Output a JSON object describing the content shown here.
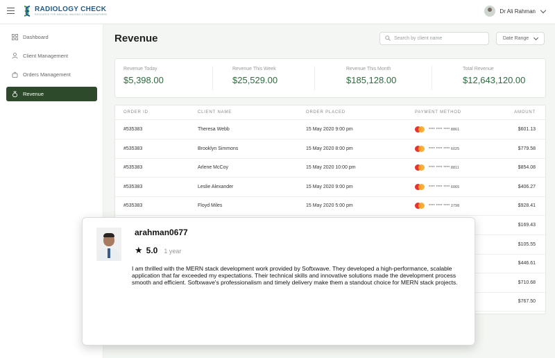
{
  "app": {
    "logo_title": "RADIOLOGY CHECK",
    "logo_subtitle": "RESOURCE FOR MEDICAL IMAGING & RADIOGRAPHERS"
  },
  "header": {
    "user_name": "Dr Ali Rahman"
  },
  "sidebar": {
    "items": [
      {
        "label": "Dashboard",
        "icon": "dashboard-icon",
        "active": false
      },
      {
        "label": "Client Management",
        "icon": "user-icon",
        "active": false
      },
      {
        "label": "Orders Management",
        "icon": "bag-icon",
        "active": false
      },
      {
        "label": "Revenue",
        "icon": "money-bag-icon",
        "active": true
      }
    ]
  },
  "page": {
    "title": "Revenue",
    "search_placeholder": "Search by client name",
    "date_range_label": "Date Range"
  },
  "stats": [
    {
      "label": "Revenue Today",
      "value": "$5,398.00"
    },
    {
      "label": "Revenue This Week",
      "value": "$25,529.00"
    },
    {
      "label": "Revenue This Month",
      "value": "$185,128.00"
    },
    {
      "label": "Total Revenue",
      "value": "$12,643,120.00"
    }
  ],
  "table": {
    "headers": [
      "ORDER ID",
      "CLIENT NAME",
      "ORDER PLACED",
      "PAYMENT METHOD",
      "AMOUNT"
    ],
    "rows": [
      {
        "order_id": "#535383",
        "client": "Theresa Webb",
        "placed": "15 May 2020 9:00 pm",
        "card": "**** **** **** 8861",
        "amount": "$601.13"
      },
      {
        "order_id": "#535383",
        "client": "Brooklyn Simmons",
        "placed": "15 May 2020 8:00 pm",
        "card": "**** **** **** 6025",
        "amount": "$779.58"
      },
      {
        "order_id": "#535383",
        "client": "Arlene McCoy",
        "placed": "15 May 2020 10:00 pm",
        "card": "**** **** **** 8811",
        "amount": "$854.08"
      },
      {
        "order_id": "#535383",
        "client": "Leslie Alexander",
        "placed": "15 May 2020 9:00 pm",
        "card": "**** **** **** 6065",
        "amount": "$406.27"
      },
      {
        "order_id": "#535383",
        "client": "Floyd Miles",
        "placed": "15 May 2020 5:00 pm",
        "card": "**** **** **** 2798",
        "amount": "$928.41"
      },
      {
        "order_id": "",
        "client": "",
        "placed": "",
        "card": "",
        "amount": "$169.43"
      },
      {
        "order_id": "",
        "client": "",
        "placed": "",
        "card": "",
        "amount": "$105.55"
      },
      {
        "order_id": "",
        "client": "",
        "placed": "",
        "card": "",
        "amount": "$446.61"
      },
      {
        "order_id": "",
        "client": "",
        "placed": "",
        "card": "",
        "amount": "$710.68"
      },
      {
        "order_id": "",
        "client": "",
        "placed": "",
        "card": "",
        "amount": "$767.50"
      }
    ]
  },
  "review": {
    "username": "arahman0677",
    "score": "5.0",
    "time_ago": "1 year",
    "text": "I am thrilled with the MERN stack development work provided by Softxwave. They developed a high-performance, scalable application that far exceeded my expectations. Their technical skills and innovative solutions made the development process smooth and efficient. Softxwave's professionalism and timely delivery make them a standout choice for MERN stack projects."
  },
  "colors": {
    "accent_dark_green": "#2d4a2a",
    "stat_green": "#2d6a3e",
    "logo_blue": "#1f5b8a"
  }
}
